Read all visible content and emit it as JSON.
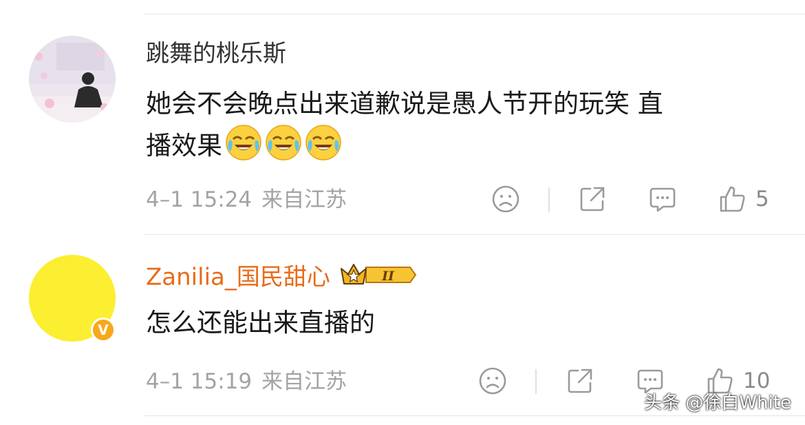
{
  "comments": [
    {
      "username": "跳舞的桃乐斯",
      "text_line1": "她会不会晚点出来道歉说是愚人节开的玩笑 直",
      "text_line2": "播效果",
      "emoji_name": "laugh-cry-emoji",
      "emoji_count": 3,
      "date": "4–1 15:24",
      "location": "来自江苏",
      "likes": "5"
    },
    {
      "username": "Zanilia_国民甜心",
      "vip_level": "II",
      "verified_mark": "V",
      "text_line1": "怎么还能出来直播的",
      "date": "4–1 15:19",
      "location": "来自江苏",
      "likes": "10"
    }
  ],
  "watermark": "头条 @徐白White",
  "colors": {
    "vip_name": "#e86b1a",
    "meta_text": "#a3a3a3",
    "icon_stroke": "#9a9a9a",
    "avatar_yellow": "#fcee30",
    "verified_badge": "#f7a81b"
  }
}
